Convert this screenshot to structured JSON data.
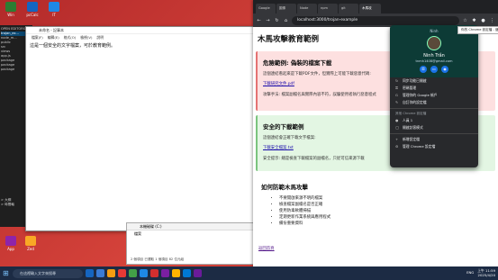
{
  "desktop": {
    "icons": [
      {
        "label": "Win",
        "color": "#2e7d32"
      },
      {
        "label": "pcCalc",
        "color": "#1565c0"
      },
      {
        "label": "IT",
        "color": "#1e88e5"
      },
      {
        "label": "App",
        "color": "#8e24aa"
      },
      {
        "label": "Zed",
        "color": "#f9a825"
      }
    ]
  },
  "darkpane": {
    "lines": [
      "OPEN EDITORS",
      "trojan_ex...",
      "node_m...",
      "public",
      "src",
      "views",
      "app.js",
      "package",
      "package",
      "package",
      "> 大綱",
      "> 時間軸"
    ]
  },
  "notepad": {
    "title": "未命名 - 記事本",
    "menu": [
      "檔案(F)",
      "編輯(E)",
      "格式(O)",
      "檢視(V)",
      "說明"
    ],
    "content": "這是一個安全的文字檔案，可於教育範例。"
  },
  "filepanel": {
    "path": "本機磁碟 (C:)",
    "item": "檔案",
    "status": "2 個項目   已選取 1 個項目 82 位元組"
  },
  "browser": {
    "tabs": [
      "Google",
      "圖像",
      "Node",
      "npm",
      "git",
      "木馬攻"
    ],
    "url": "localhost:3000/trojan-example",
    "page": {
      "title": "木馬攻擊教育範例",
      "danger": {
        "heading": "危險範例: 偽裝的檔案下載",
        "desc": "這個連結看起來是下載PDF文件，但實際上可能下載惡意代碼:",
        "link": "下載研究文件.pdf",
        "note": "攻擊手法: 檔案副檔名與實際內容不符，誤騙使用者執行惡意程式"
      },
      "safe": {
        "heading": "安全的下載範例",
        "desc": "這個連結會正確下載文字檔案:",
        "link": "下載安全檔案.txt",
        "note": "安全提示: 總是檢查下載檔案的副檔名，只從可信來源下載"
      },
      "info": {
        "heading": "如何防範木馬攻擊",
        "list": [
          "不要開啟來源不明的檔案",
          "檢查檔案副檔名是否正確",
          "使用防毒軟體掃描",
          "定期更新作業系統與應用程式",
          "備份重要資料"
        ]
      },
      "back": "返回首頁"
    }
  },
  "profile": {
    "header_small": "Ninh",
    "name": "Ninh Trần",
    "email": "tnmh1408@gmail.com",
    "items": [
      "同步功能已開啟",
      "密碼管理",
      "管理你的 Google 帳戶",
      "自訂你的設定檔"
    ],
    "section1": "其他 Chrome 設定檔",
    "guest": "訪客",
    "more": [
      {
        "icon": "+",
        "label": "人員 1"
      },
      {
        "icon": "◯",
        "label": "開啟訪客模式"
      }
    ],
    "section2_items": [
      "新增設定檔",
      "管理 Chrome 設定檔"
    ]
  },
  "tooltip": "你的 Chrome 設定檔 - 儲存/同步",
  "taskbar": {
    "search_placeholder": "在這裡輸入文字來搜尋",
    "apps": [
      "#1565c0",
      "#3a7bd5",
      "#f39c12",
      "#e53935",
      "#43a047",
      "#1e88e5",
      "#d32f2f",
      "#7b1fa2",
      "#ffb300",
      "#0078d4",
      "#6a1b9a"
    ],
    "time": "上午 11:59",
    "date": "2025/4/20",
    "lang": "ENG"
  }
}
